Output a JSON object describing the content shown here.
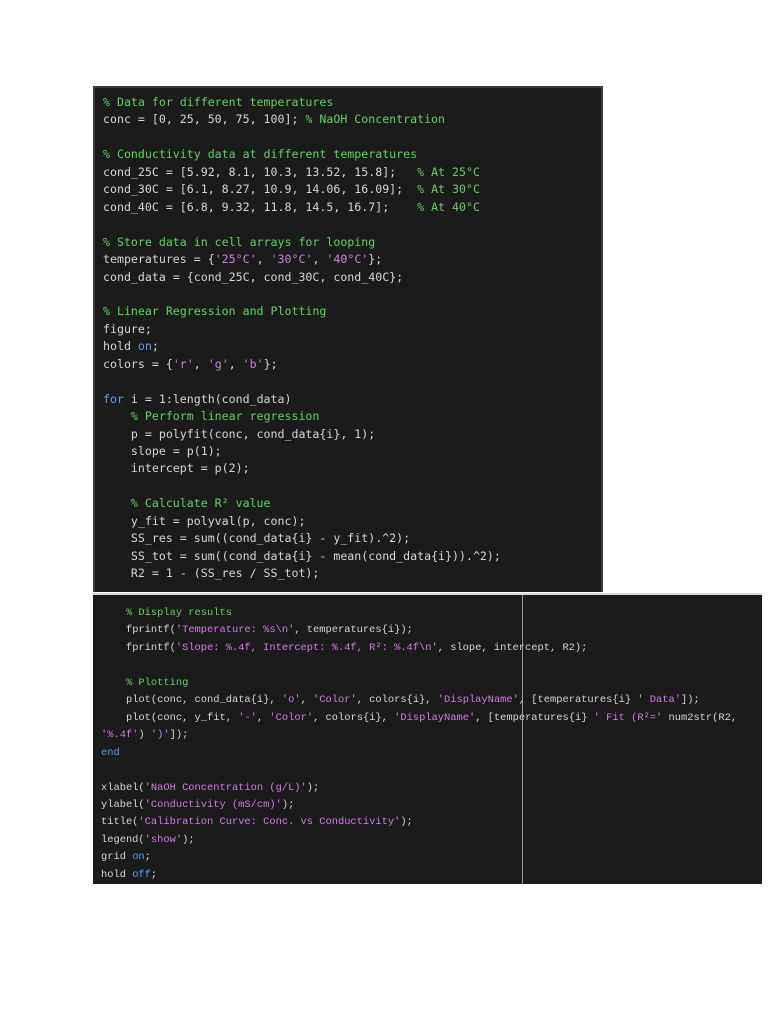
{
  "code_block_1": [
    [
      [
        "c",
        "% Data for different temperatures"
      ]
    ],
    [
      [
        "t",
        "conc = [0, 25, 50, 75, 100]; "
      ],
      [
        "c",
        "% NaOH Concentration"
      ]
    ],
    [],
    [
      [
        "c",
        "% Conductivity data at different temperatures"
      ]
    ],
    [
      [
        "t",
        "cond_25C = [5.92, 8.1, 10.3, 13.52, 15.8];   "
      ],
      [
        "c",
        "% At 25°C"
      ]
    ],
    [
      [
        "t",
        "cond_30C = [6.1, 8.27, 10.9, 14.06, 16.09];  "
      ],
      [
        "c",
        "% At 30°C"
      ]
    ],
    [
      [
        "t",
        "cond_40C = [6.8, 9.32, 11.8, 14.5, 16.7];    "
      ],
      [
        "c",
        "% At 40°C"
      ]
    ],
    [],
    [
      [
        "c",
        "% Store data in cell arrays for looping"
      ]
    ],
    [
      [
        "t",
        "temperatures = {"
      ],
      [
        "s",
        "'25°C'"
      ],
      [
        "t",
        ", "
      ],
      [
        "s",
        "'30°C'"
      ],
      [
        "t",
        ", "
      ],
      [
        "s",
        "'40°C'"
      ],
      [
        "t",
        "};"
      ]
    ],
    [
      [
        "t",
        "cond_data = {cond_25C, cond_30C, cond_40C};"
      ]
    ],
    [],
    [
      [
        "c",
        "% Linear Regression and Plotting"
      ]
    ],
    [
      [
        "t",
        "figure;"
      ]
    ],
    [
      [
        "t",
        "hold "
      ],
      [
        "k",
        "on"
      ],
      [
        "t",
        ";"
      ]
    ],
    [
      [
        "t",
        "colors = {"
      ],
      [
        "s",
        "'r'"
      ],
      [
        "t",
        ", "
      ],
      [
        "s",
        "'g'"
      ],
      [
        "t",
        ", "
      ],
      [
        "s",
        "'b'"
      ],
      [
        "t",
        "};"
      ]
    ],
    [],
    [
      [
        "k",
        "for"
      ],
      [
        "t",
        " i = 1:length(cond_data)"
      ]
    ],
    [
      [
        "t",
        "    "
      ],
      [
        "c",
        "% Perform linear regression"
      ]
    ],
    [
      [
        "t",
        "    p = polyfit(conc, cond_data{i}, 1);"
      ]
    ],
    [
      [
        "t",
        "    slope = p(1);"
      ]
    ],
    [
      [
        "t",
        "    intercept = p(2);"
      ]
    ],
    [],
    [
      [
        "t",
        "    "
      ],
      [
        "c",
        "% Calculate R² value"
      ]
    ],
    [
      [
        "t",
        "    y_fit = polyval(p, conc);"
      ]
    ],
    [
      [
        "t",
        "    SS_res = sum((cond_data{i} - y_fit).^2);"
      ]
    ],
    [
      [
        "t",
        "    SS_tot = sum((cond_data{i} - mean(cond_data{i})).^2);"
      ]
    ],
    [
      [
        "t",
        "    R2 = 1 - (SS_res / SS_tot);"
      ]
    ]
  ],
  "code_block_2": [
    [
      [
        "t",
        "    "
      ],
      [
        "c",
        "% Display results"
      ]
    ],
    [
      [
        "t",
        "    fprintf("
      ],
      [
        "s",
        "'Temperature: %s\\n'"
      ],
      [
        "t",
        ", temperatures{i});"
      ]
    ],
    [
      [
        "t",
        "    fprintf("
      ],
      [
        "s",
        "'Slope: %.4f, Intercept: %.4f, R²: %.4f\\n'"
      ],
      [
        "t",
        ", slope, intercept, R2);"
      ]
    ],
    [],
    [
      [
        "t",
        "    "
      ],
      [
        "c",
        "% Plotting"
      ]
    ],
    [
      [
        "t",
        "    plot(conc, cond_data{i}, "
      ],
      [
        "s",
        "'o'"
      ],
      [
        "t",
        ", "
      ],
      [
        "s",
        "'Color'"
      ],
      [
        "t",
        ", colors{i}, "
      ],
      [
        "s",
        "'DisplayName'"
      ],
      [
        "t",
        ", [temperatures{i} "
      ],
      [
        "s",
        "' Data'"
      ],
      [
        "t",
        "]);"
      ]
    ],
    [
      [
        "t",
        "    plot(conc, y_fit, "
      ],
      [
        "s",
        "'-'"
      ],
      [
        "t",
        ", "
      ],
      [
        "s",
        "'Color'"
      ],
      [
        "t",
        ", colors{i}, "
      ],
      [
        "s",
        "'DisplayName'"
      ],
      [
        "t",
        ", [temperatures{i} "
      ],
      [
        "s",
        "' Fit (R²='"
      ],
      [
        "t",
        " num2str(R2, "
      ],
      [
        "s",
        "'%.4f'"
      ],
      [
        "t",
        ") "
      ],
      [
        "s",
        "')'"
      ],
      [
        "t",
        "]);"
      ]
    ],
    [
      [
        "k",
        "end"
      ]
    ],
    [],
    [
      [
        "t",
        "xlabel("
      ],
      [
        "s",
        "'NaOH Concentration (g/L)'"
      ],
      [
        "t",
        ");"
      ]
    ],
    [
      [
        "t",
        "ylabel("
      ],
      [
        "s",
        "'Conductivity (mS/cm)'"
      ],
      [
        "t",
        ");"
      ]
    ],
    [
      [
        "t",
        "title("
      ],
      [
        "s",
        "'Calibration Curve: Conc. vs Conductivity'"
      ],
      [
        "t",
        ");"
      ]
    ],
    [
      [
        "t",
        "legend("
      ],
      [
        "s",
        "'show'"
      ],
      [
        "t",
        ");"
      ]
    ],
    [
      [
        "t",
        "grid "
      ],
      [
        "k",
        "on"
      ],
      [
        "t",
        ";"
      ]
    ],
    [
      [
        "t",
        "hold "
      ],
      [
        "k",
        "off"
      ],
      [
        "t",
        ";"
      ]
    ]
  ]
}
